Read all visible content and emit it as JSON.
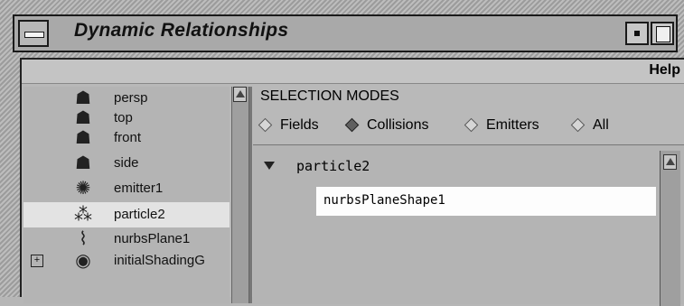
{
  "window": {
    "title": "Dynamic Relationships"
  },
  "menubar": {
    "help_label": "Help"
  },
  "outliner": {
    "items": [
      {
        "label": "persp",
        "icon": "camera-icon",
        "selected": false
      },
      {
        "label": "top",
        "icon": "camera-icon",
        "selected": false
      },
      {
        "label": "front",
        "icon": "camera-icon",
        "selected": false
      },
      {
        "label": "side",
        "icon": "camera-icon",
        "selected": false
      },
      {
        "label": "emitter1",
        "icon": "emitter-icon",
        "selected": false
      },
      {
        "label": "particle2",
        "icon": "particle-icon",
        "selected": true
      },
      {
        "label": "nurbsPlane1",
        "icon": "nurbs-plane-icon",
        "selected": false
      },
      {
        "label": "initialShadingG",
        "icon": "shading-group-icon",
        "selected": false
      }
    ]
  },
  "selection_modes": {
    "heading": "SELECTION MODES",
    "options": [
      {
        "label": "Fields",
        "selected": false
      },
      {
        "label": "Collisions",
        "selected": true
      },
      {
        "label": "Emitters",
        "selected": false
      },
      {
        "label": "All",
        "selected": false
      }
    ]
  },
  "relationships": {
    "parent": "particle2",
    "children": [
      "nurbsPlaneShape1"
    ]
  }
}
